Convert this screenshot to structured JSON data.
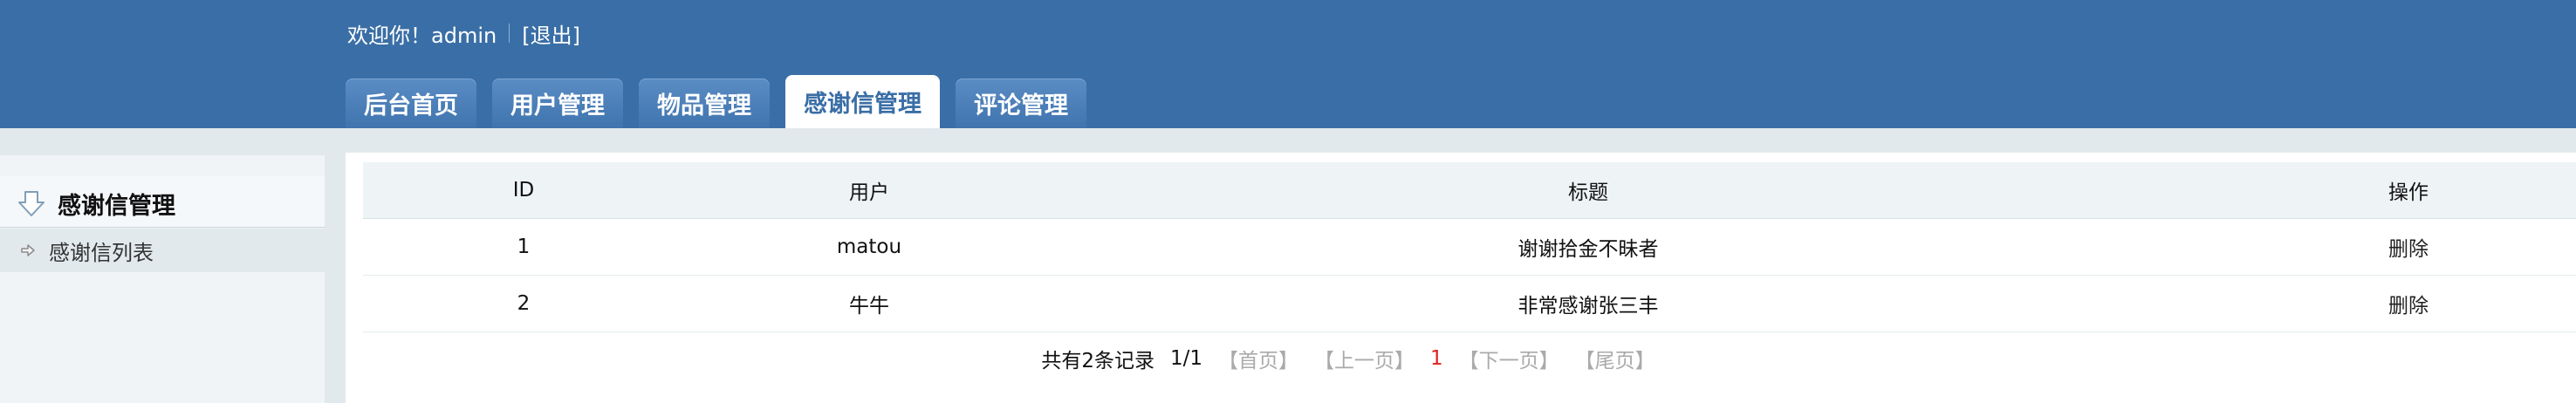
{
  "header": {
    "welcome_text": "欢迎你！admin",
    "logout_label": "[退出]"
  },
  "tabs": [
    {
      "label": "后台首页",
      "active": false
    },
    {
      "label": "用户管理",
      "active": false
    },
    {
      "label": "物品管理",
      "active": false
    },
    {
      "label": "感谢信管理",
      "active": true
    },
    {
      "label": "评论管理",
      "active": false
    }
  ],
  "sidebar": {
    "title": "感谢信管理",
    "title_icon": "down-arrow-icon",
    "items": [
      {
        "label": "感谢信列表",
        "icon": "right-arrow-icon"
      }
    ]
  },
  "table": {
    "columns": [
      "ID",
      "用户",
      "标题",
      "操作"
    ],
    "rows": [
      {
        "id": "1",
        "user": "matou",
        "title": "谢谢拾金不昧者",
        "action": "删除"
      },
      {
        "id": "2",
        "user": "牛牛",
        "title": "非常感谢张三丰",
        "action": "删除"
      }
    ]
  },
  "pager": {
    "total": "共有2条记录",
    "pages": "1/1",
    "first": "【首页】",
    "prev": "【上一页】",
    "current": "1",
    "next": "【下一页】",
    "last": "【尾页】"
  },
  "colors": {
    "header_bg": "#3a6ea6",
    "current_page": "#e02020"
  }
}
